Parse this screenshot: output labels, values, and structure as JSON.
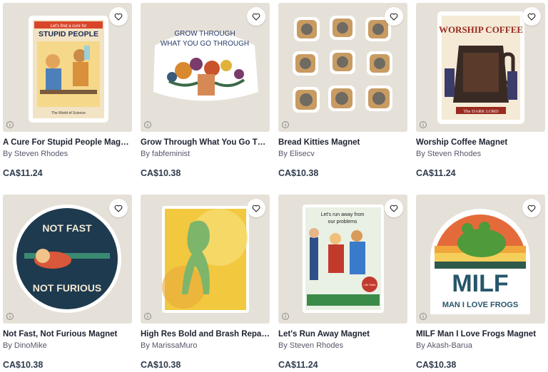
{
  "products": [
    {
      "title": "A Cure For Stupid People Magnet",
      "artist": "By Steven Rhodes",
      "price": "CA$11.24",
      "art_text": {
        "banner": "Let's find a cure for",
        "headline": "STUPID PEOPLE",
        "footer": "The World of Science"
      }
    },
    {
      "title": "Grow Through What You Go Through Magnet",
      "artist": "By fabfeminist",
      "price": "CA$10.38",
      "art_text": {
        "line1": "GROW THROUGH",
        "line2": "WHAT YOU GO THROUGH"
      }
    },
    {
      "title": "Bread Kitties Magnet",
      "artist": "By Elisecv",
      "price": "CA$10.38",
      "art_text": {}
    },
    {
      "title": "Worship Coffee Magnet",
      "artist": "By Steven Rhodes",
      "price": "CA$11.24",
      "art_text": {
        "headline": "WORSHIP COFFEE",
        "footer": "The DARK LORD"
      }
    },
    {
      "title": "Not Fast, Not Furious Magnet",
      "artist": "By DinoMike",
      "price": "CA$10.38",
      "art_text": {
        "top": "NOT FAST",
        "bottom": "NOT FURIOUS"
      }
    },
    {
      "title": "High Res Bold and Brash Repaint Magnet",
      "artist": "By MarissaMuro",
      "price": "CA$10.38",
      "art_text": {}
    },
    {
      "title": "Let's Run Away Magnet",
      "artist": "By Steven Rhodes",
      "price": "CA$11.24",
      "art_text": {
        "line1": "Let's run away from",
        "line2": "our problems",
        "badge": "Life Skills"
      }
    },
    {
      "title": "MILF Man I Love Frogs Magnet",
      "artist": "By Akash-Barua",
      "price": "CA$10.38",
      "art_text": {
        "headline": "MILF",
        "sub": "MAN I LOVE FROGS"
      }
    }
  ],
  "colors": {
    "thumb_bg": "#e6e1d8",
    "title": "#202432",
    "artist": "#55576a",
    "price": "#2f3b4d"
  },
  "icons": {
    "favorite": "heart-outline-icon",
    "info": "info-circle-icon"
  }
}
